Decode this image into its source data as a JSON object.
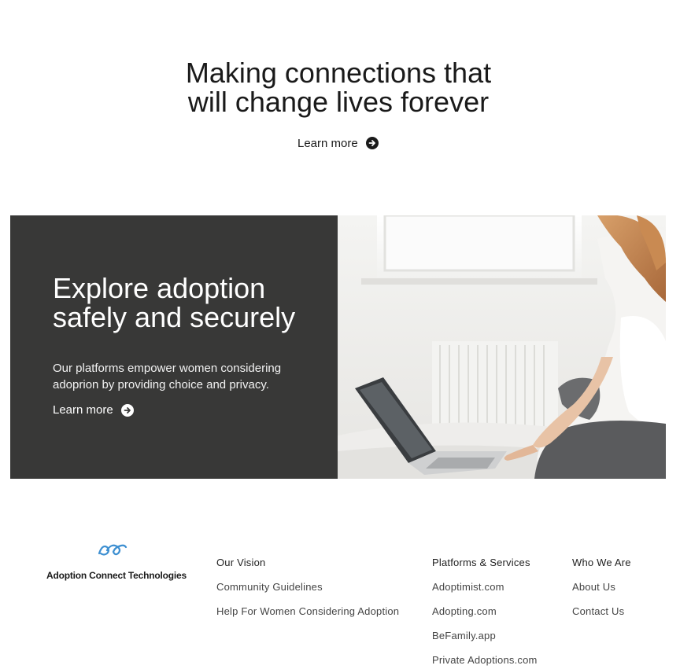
{
  "hero": {
    "title_line1": "Making connections that",
    "title_line2": "will change lives forever",
    "cta_label": "Learn more"
  },
  "feature": {
    "title_line1": "Explore adoption",
    "title_line2": "safely and securely",
    "description": "Our platforms empower women considering adoprion by providing choice and privacy.",
    "cta_label": "Learn more",
    "panel_color": "#383837"
  },
  "footer": {
    "logo_text": "Adoption Connect Technologies",
    "logo_color": "#3d8fd1",
    "columns": [
      {
        "links": [
          "Our Vision",
          "Community Guidelines",
          "Help For Women Considering Adoption"
        ]
      },
      {
        "links": [
          "Platforms & Services",
          "Adoptimist.com",
          "Adopting.com",
          "BeFamily.app",
          "Private Adoptions.com"
        ]
      },
      {
        "links": [
          "Who We Are",
          "About Us",
          "Contact Us"
        ]
      }
    ]
  }
}
